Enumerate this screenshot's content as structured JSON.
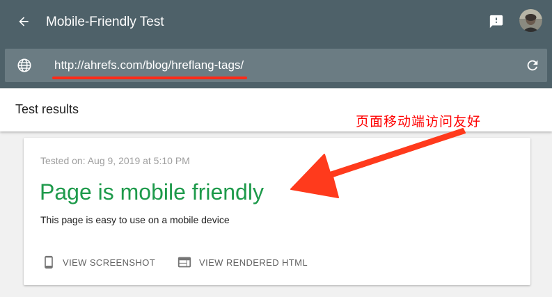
{
  "header": {
    "title": "Mobile-Friendly Test",
    "back_icon": "arrow-back-icon",
    "feedback_icon": "feedback-icon",
    "avatar_icon": "avatar"
  },
  "urlbar": {
    "value": "http://ahrefs.com/blog/hreflang-tags/",
    "globe_icon": "globe-icon",
    "reload_icon": "reload-icon"
  },
  "results": {
    "title": "Test results",
    "annotation": "页面移动端访问友好"
  },
  "card": {
    "tested_on": "Tested on: Aug 9, 2019 at 5:10 PM",
    "status": "Page is mobile friendly",
    "description": "This page is easy to use on a mobile device",
    "actions": [
      {
        "label": "VIEW SCREENSHOT",
        "icon": "phone-icon"
      },
      {
        "label": "VIEW RENDERED HTML",
        "icon": "web-icon"
      }
    ]
  },
  "colors": {
    "header_bg": "#4e6169",
    "urlbar_bg": "#6b7c83",
    "success_green": "#1e9a4b",
    "annotation_red": "#ff0000"
  }
}
